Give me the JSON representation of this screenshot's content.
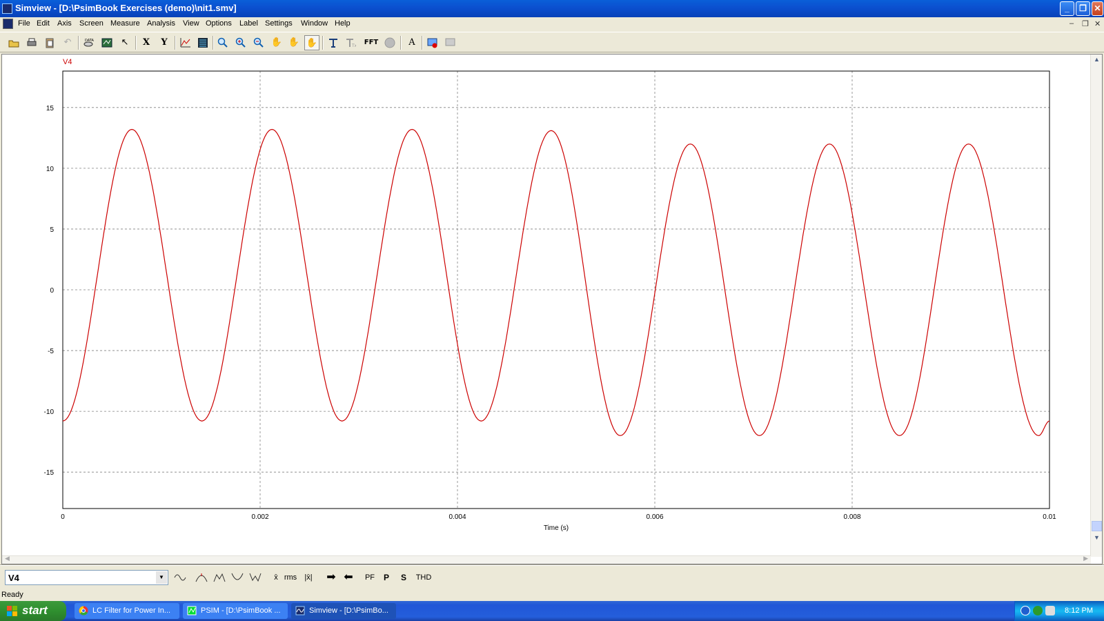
{
  "window": {
    "title": "Simview - [D:\\PsimBook Exercises (demo)\\nit1.smv]"
  },
  "menu": [
    "File",
    "Edit",
    "Axis",
    "Screen",
    "Measure",
    "Analysis",
    "View",
    "Options",
    "Label",
    "Settings",
    "Window",
    "Help"
  ],
  "toolbar": {
    "x_label": "X",
    "y_label": "Y",
    "fft_label": "FFT",
    "text_label": "A",
    "icons": [
      "open-icon",
      "print-icon",
      "paste-icon",
      "undo-icon",
      "data-icon",
      "add-curve-icon",
      "select-icon",
      "x-axis-icon",
      "y-axis-icon",
      "curve-icon",
      "table-icon",
      "zoom-icon",
      "zoom-in-icon",
      "zoom-out-icon",
      "pan-hand-icon",
      "pan-vertical-icon",
      "pan-horizontal-icon",
      "marker-icon",
      "marker-text-icon",
      "fft-icon",
      "harmonic-icon",
      "text-icon",
      "record-icon",
      "exit-record-icon"
    ]
  },
  "bottom": {
    "curve_select": "V4",
    "buttons": {
      "rms": "rms",
      "pf": "PF",
      "p": "P",
      "s": "S",
      "thd": "THD"
    }
  },
  "status": "Ready",
  "taskbar": {
    "start": "start",
    "tasks": [
      {
        "label": "LC Filter for Power In...",
        "icon": "chrome-icon",
        "active": false
      },
      {
        "label": "PSIM - [D:\\PsimBook ...",
        "icon": "psim-icon",
        "active": false
      },
      {
        "label": "Simview - [D:\\PsimBo...",
        "icon": "simview-icon",
        "active": true
      }
    ],
    "clock": "8:12 PM"
  },
  "colors": {
    "trace": "#cc0000",
    "grid": "#808080",
    "titlebar": "#0b4fcf",
    "taskbar": "#245edb"
  },
  "chart_data": {
    "type": "line",
    "title": "V4",
    "xlabel": "Time (s)",
    "ylabel": "",
    "xlim": [
      0,
      0.01
    ],
    "ylim": [
      -18,
      18
    ],
    "xticks": [
      0,
      0.002,
      0.004,
      0.006,
      0.008,
      0.01
    ],
    "xtick_labels": [
      "0",
      "0.002",
      "0.004",
      "0.006",
      "0.008",
      "0.01"
    ],
    "yticks": [
      15,
      10,
      5,
      0,
      -5,
      -10,
      -15
    ],
    "ytick_labels": [
      "15",
      "10",
      "5",
      "0",
      "-5",
      "-10",
      "-15"
    ],
    "grid": true,
    "legend": "none",
    "series": [
      {
        "name": "V4",
        "color": "#cc0000",
        "x": [
          0,
          0.0007,
          0.00141,
          0.00212,
          0.00283,
          0.00354,
          0.00424,
          0.00495,
          0.00565,
          0.00636,
          0.00706,
          0.00777,
          0.00848,
          0.00918,
          0.00989,
          0.01
        ],
        "y": [
          -10.8,
          13.2,
          -10.8,
          13.2,
          -10.8,
          13.2,
          -10.8,
          13.1,
          -12.0,
          12.0,
          -12.0,
          12.0,
          -12.0,
          12.0,
          -12.0,
          -10.8
        ]
      }
    ]
  }
}
